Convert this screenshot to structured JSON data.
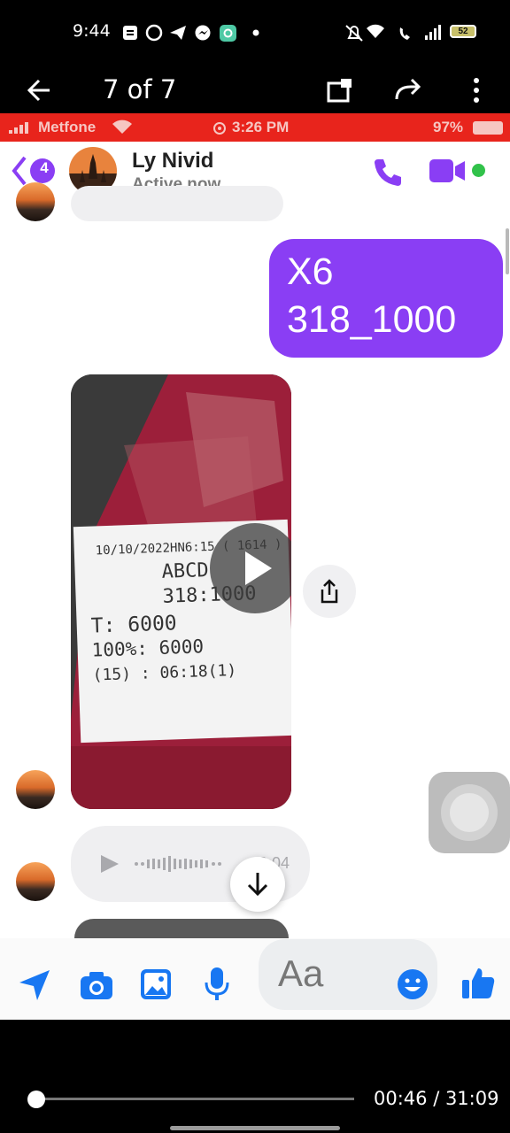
{
  "android_status": {
    "time": "9:44",
    "battery": "52"
  },
  "viewer": {
    "title": "7 of 7"
  },
  "ios_status": {
    "carrier": "Metfone",
    "time": "3:26 PM",
    "battery": "97%"
  },
  "chat": {
    "back_badge": "4",
    "contact_name": "Ly Nivid",
    "contact_status": "Active now",
    "sent_message": "X6\n318_1000",
    "receipt_lines": [
      "10/10/2022HN6:15 ( 1614 )",
      "ABCD",
      "318:1000",
      "T: 6000",
      "100%: 6000",
      "(15)  : 06:18(1)"
    ],
    "audio_duration": "0:04",
    "composer_placeholder": "Aa"
  },
  "player": {
    "progress": 0.025,
    "time": "00:46 / 31:09"
  },
  "colors": {
    "messenger_purple": "#8a3ef4",
    "messenger_blue": "#1877f2",
    "ios_status_red": "#e8241c",
    "active_green": "#31c24a"
  }
}
